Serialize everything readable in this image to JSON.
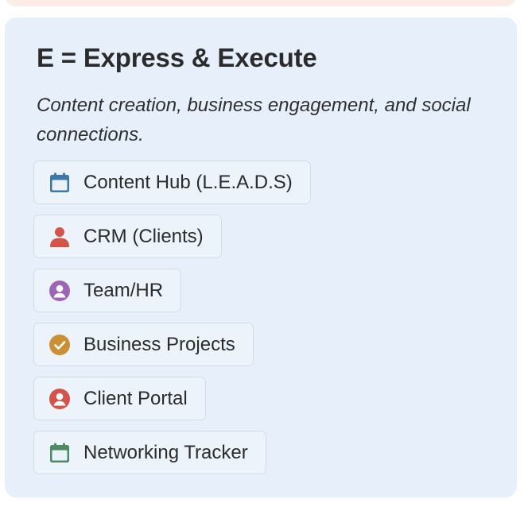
{
  "card": {
    "title": "E = Express & Execute",
    "description": "Content creation, business engagement, and social connections."
  },
  "links": [
    {
      "label": "Content Hub (L.E.A.D.S)",
      "icon": "calendar-icon",
      "color": "#3f77a6"
    },
    {
      "label": "CRM (Clients)",
      "icon": "person-icon",
      "color": "#d2544b"
    },
    {
      "label": "Team/HR",
      "icon": "person-circle-icon",
      "color": "#9a66b5"
    },
    {
      "label": "Business Projects",
      "icon": "check-circle-icon",
      "color": "#c99036"
    },
    {
      "label": "Client Portal",
      "icon": "person-circle-icon",
      "color": "#d2544b"
    },
    {
      "label": "Networking Tracker",
      "icon": "calendar-icon",
      "color": "#4f8a62"
    }
  ]
}
